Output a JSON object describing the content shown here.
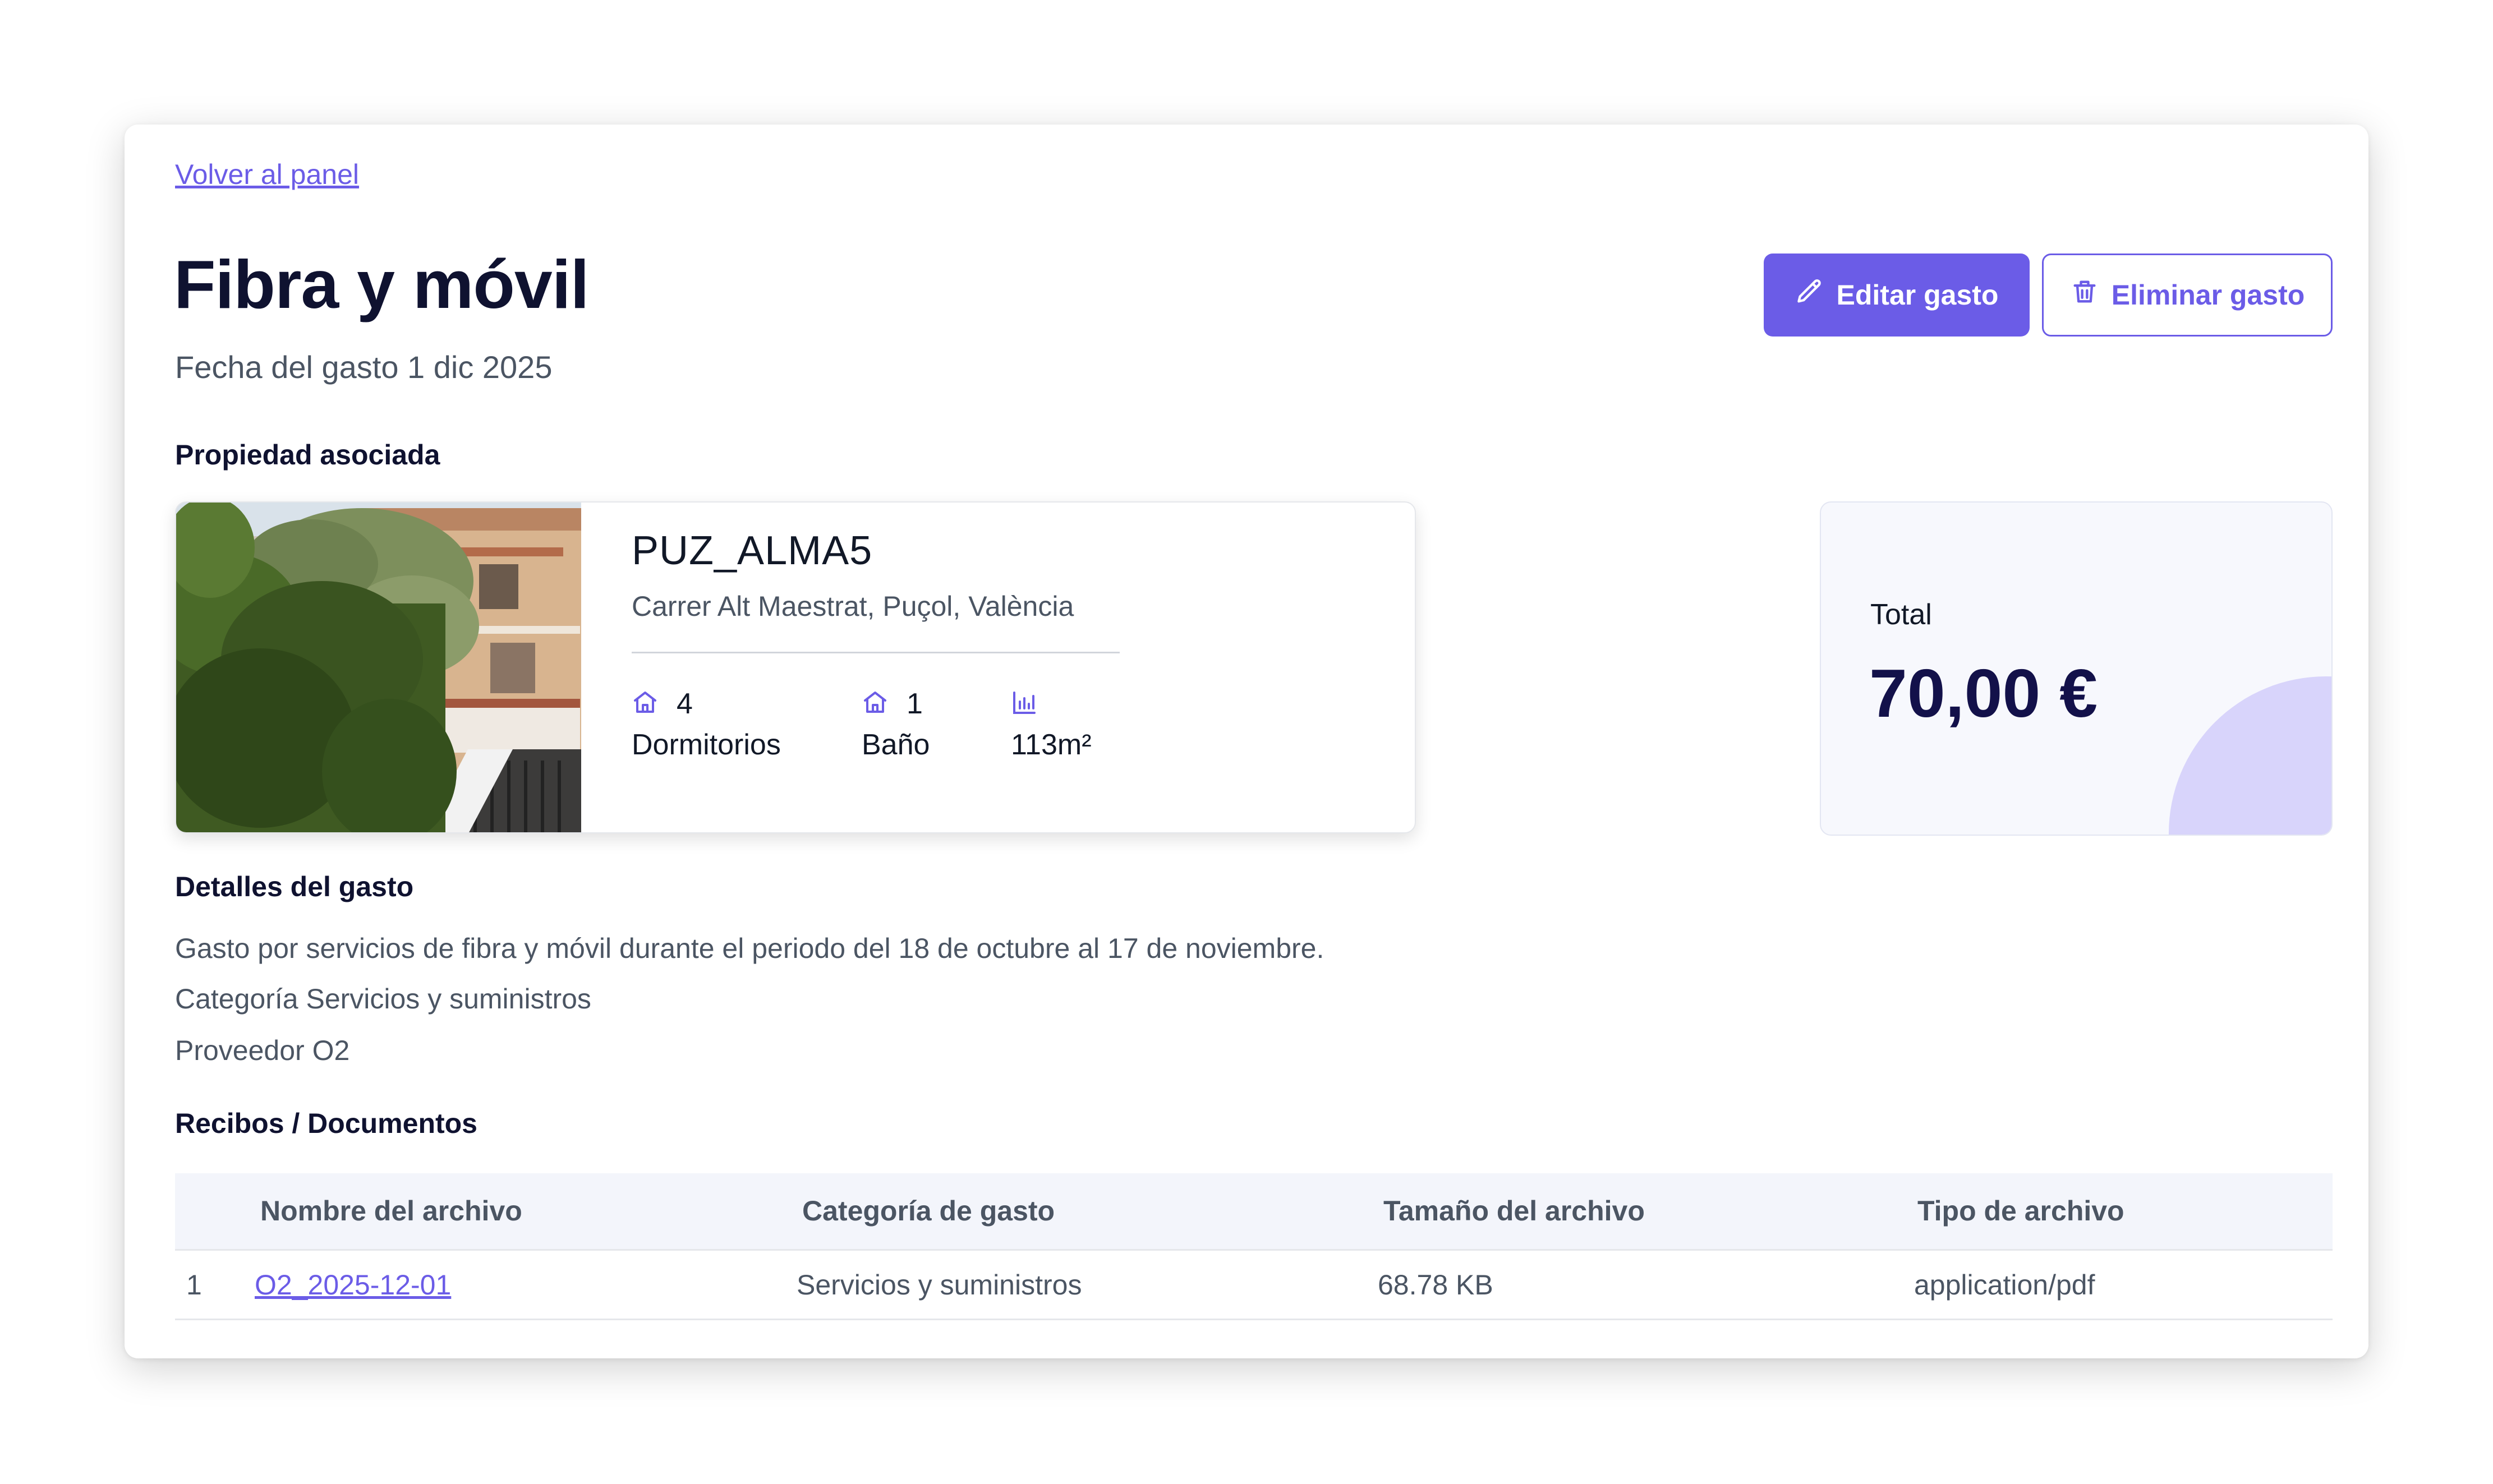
{
  "nav": {
    "back_label": "Volver al panel"
  },
  "header": {
    "title": "Fibra y móvil",
    "date_line": "Fecha del gasto 1 dic 2025"
  },
  "actions": {
    "edit_label": "Editar gasto",
    "delete_label": "Eliminar gasto"
  },
  "property": {
    "section_title": "Propiedad asociada",
    "name": "PUZ_ALMA5",
    "address": "Carrer Alt Maestrat, Puçol, València",
    "bedrooms_value": "4",
    "bedrooms_label": "Dormitorios",
    "baths_value": "1",
    "baths_label": "Baño",
    "area_label": "113m²"
  },
  "total": {
    "label": "Total",
    "value": "70,00 €"
  },
  "details": {
    "section_title": "Detalles del gasto",
    "description": "Gasto por servicios de fibra y móvil durante el periodo del 18 de octubre al 17 de noviembre.",
    "category_line": "Categoría Servicios y suministros",
    "provider_line": "Proveedor O2"
  },
  "documents": {
    "section_title": "Recibos / Documentos",
    "columns": [
      "Nombre del archivo",
      "Categoría de gasto",
      "Tamaño del archivo",
      "Tipo de archivo"
    ],
    "rows": [
      {
        "index": "1",
        "name": "O2_2025-12-01",
        "category": "Servicios y suministros",
        "size": "68.78 KB",
        "type": "application/pdf"
      }
    ]
  },
  "colors": {
    "accent": "#6b5ce7",
    "title": "#0f1230",
    "total_value": "#13114a",
    "decor_circle": "#d8d4fb"
  }
}
